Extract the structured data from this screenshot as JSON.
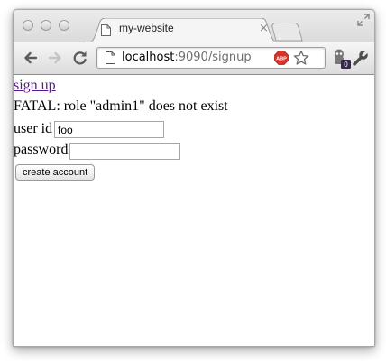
{
  "browser": {
    "tab": {
      "title": "my-website",
      "close_glyph": "×",
      "favicon": "page-icon"
    },
    "toolbar": {
      "back_icon": "back-arrow-icon",
      "forward_icon": "forward-arrow-icon",
      "reload_icon": "reload-icon",
      "url_host": "localhost",
      "url_rest": ":9090/signup",
      "adblock_label": "ABP",
      "extension_badge": "0",
      "wrench_icon": "wrench-icon",
      "star_icon": "star-icon"
    }
  },
  "page": {
    "signup_link": "sign up",
    "error_message": "FATAL: role \"admin1\" does not exist",
    "userid_label": "user id",
    "userid_value": "foo",
    "password_label": "password",
    "password_value": "",
    "create_button": "create account"
  },
  "colors": {
    "visited_link": "#551a8b",
    "adblock_red": "#d9322b",
    "badge_dark": "#3a2a4a"
  }
}
